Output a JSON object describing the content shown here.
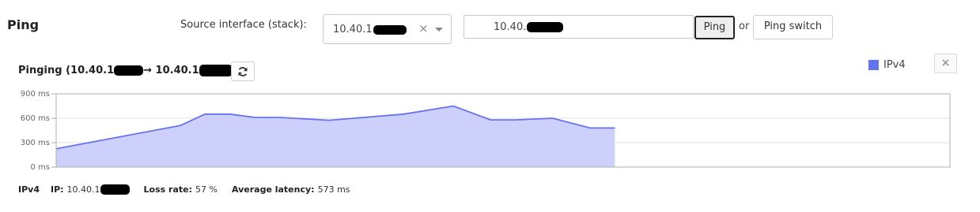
{
  "page": {
    "title": "Ping"
  },
  "source": {
    "label": "Source interface (stack):",
    "selected_value": "10.40.1",
    "clear_icon": "×"
  },
  "target": {
    "value": "10.40."
  },
  "buttons": {
    "ping": "Ping",
    "or": "or",
    "ping_switch": "Ping switch"
  },
  "pinging": {
    "prefix": "Pinging (10.40.1",
    "arrow": "→ 10.40.1",
    "suffix": ")"
  },
  "legend": {
    "label": "IPv4",
    "color": "#6673f0"
  },
  "close_icon": "×",
  "footer": {
    "protocol": "IPv4",
    "ip_label": "IP:",
    "ip_value": "10.40.1",
    "loss_label": "Loss rate:",
    "loss_value": "57 %",
    "latency_label": "Average latency:",
    "latency_value": "573 ms"
  },
  "chart_data": {
    "type": "area",
    "title": "",
    "xlabel": "",
    "ylabel": "",
    "y_ticks": [
      "0 ms",
      "300 ms",
      "600 ms",
      "900 ms"
    ],
    "ylim": [
      0,
      900
    ],
    "grid": true,
    "legend_position": "top-right",
    "series": [
      {
        "name": "IPv4",
        "color": "#6673f0",
        "fill": "#ccd0fa",
        "x": [
          0,
          10,
          12,
          14,
          16,
          18,
          22,
          28,
          32,
          35,
          37,
          40,
          43,
          45
        ],
        "values": [
          225,
          510,
          650,
          650,
          610,
          610,
          575,
          650,
          750,
          580,
          580,
          600,
          480,
          480
        ],
        "x_max": 72
      }
    ]
  }
}
